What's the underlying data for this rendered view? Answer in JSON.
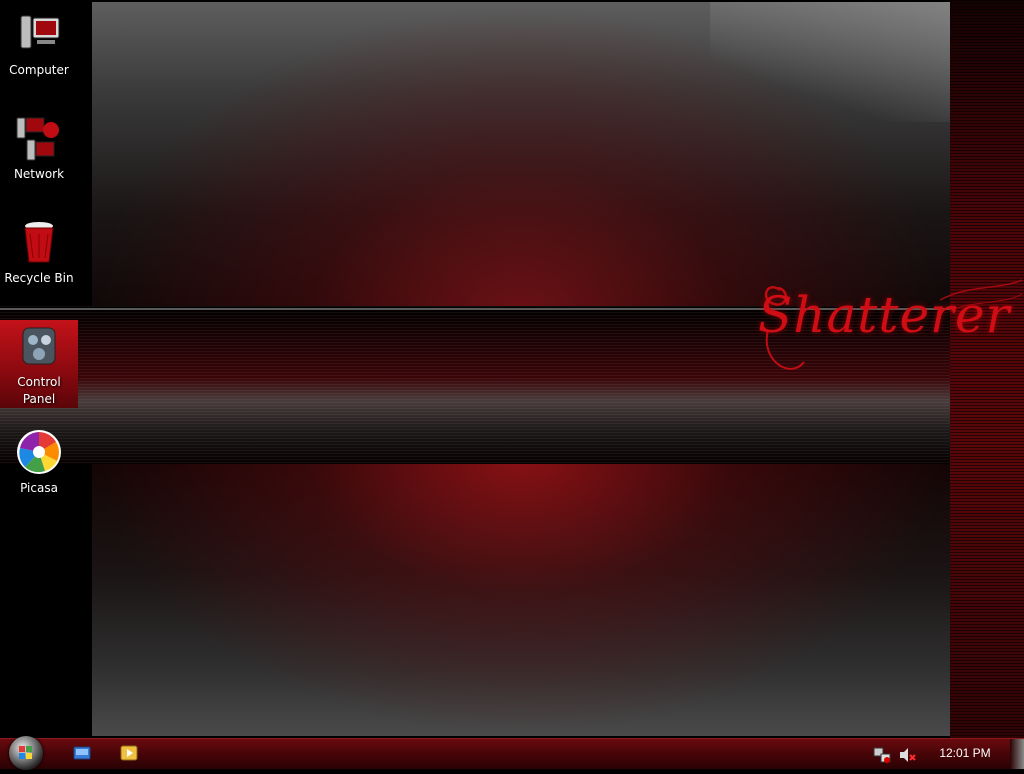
{
  "desktop": {
    "icons": [
      {
        "label": "Computer",
        "icon": "computer-icon"
      },
      {
        "label": "Network",
        "icon": "network-icon"
      },
      {
        "label": "Recycle Bin",
        "icon": "recycle-bin-icon"
      },
      {
        "label": "Control Panel",
        "icon": "control-panel-icon",
        "selected": true
      },
      {
        "label": "Picasa",
        "icon": "picasa-icon"
      }
    ],
    "wallpaper": {
      "brand_text": "Shatterer"
    }
  },
  "taskbar": {
    "start_icon": "windows-orb-icon",
    "quick_launch": [
      {
        "icon": "show-desktop-icon"
      },
      {
        "icon": "media-player-icon"
      }
    ],
    "tray": {
      "network_icon": "network-status-icon",
      "volume_icon": "volume-muted-icon"
    },
    "clock": "12:01 PM"
  },
  "colors": {
    "accent": "#c4121a",
    "taskbar": "#4a0508",
    "brand_text": "#d00d14"
  }
}
